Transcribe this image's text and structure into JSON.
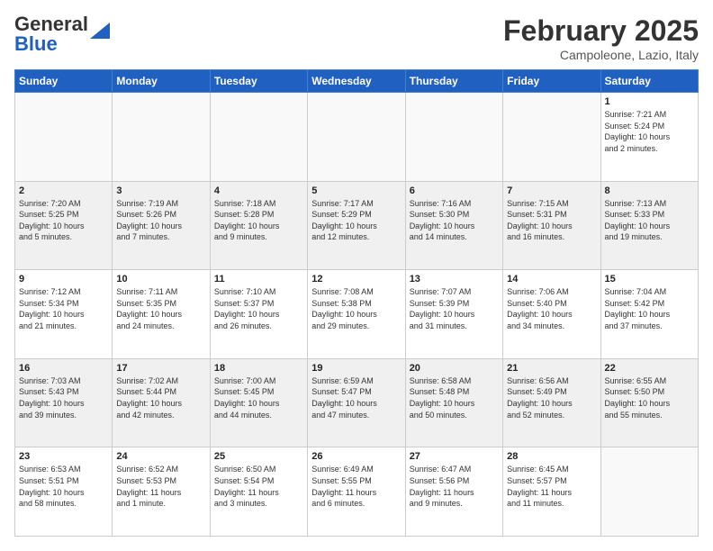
{
  "header": {
    "logo_general": "General",
    "logo_blue": "Blue",
    "month_title": "February 2025",
    "location": "Campoleone, Lazio, Italy"
  },
  "weekdays": [
    "Sunday",
    "Monday",
    "Tuesday",
    "Wednesday",
    "Thursday",
    "Friday",
    "Saturday"
  ],
  "weeks": [
    [
      {
        "day": "",
        "info": ""
      },
      {
        "day": "",
        "info": ""
      },
      {
        "day": "",
        "info": ""
      },
      {
        "day": "",
        "info": ""
      },
      {
        "day": "",
        "info": ""
      },
      {
        "day": "",
        "info": ""
      },
      {
        "day": "1",
        "info": "Sunrise: 7:21 AM\nSunset: 5:24 PM\nDaylight: 10 hours\nand 2 minutes."
      }
    ],
    [
      {
        "day": "2",
        "info": "Sunrise: 7:20 AM\nSunset: 5:25 PM\nDaylight: 10 hours\nand 5 minutes."
      },
      {
        "day": "3",
        "info": "Sunrise: 7:19 AM\nSunset: 5:26 PM\nDaylight: 10 hours\nand 7 minutes."
      },
      {
        "day": "4",
        "info": "Sunrise: 7:18 AM\nSunset: 5:28 PM\nDaylight: 10 hours\nand 9 minutes."
      },
      {
        "day": "5",
        "info": "Sunrise: 7:17 AM\nSunset: 5:29 PM\nDaylight: 10 hours\nand 12 minutes."
      },
      {
        "day": "6",
        "info": "Sunrise: 7:16 AM\nSunset: 5:30 PM\nDaylight: 10 hours\nand 14 minutes."
      },
      {
        "day": "7",
        "info": "Sunrise: 7:15 AM\nSunset: 5:31 PM\nDaylight: 10 hours\nand 16 minutes."
      },
      {
        "day": "8",
        "info": "Sunrise: 7:13 AM\nSunset: 5:33 PM\nDaylight: 10 hours\nand 19 minutes."
      }
    ],
    [
      {
        "day": "9",
        "info": "Sunrise: 7:12 AM\nSunset: 5:34 PM\nDaylight: 10 hours\nand 21 minutes."
      },
      {
        "day": "10",
        "info": "Sunrise: 7:11 AM\nSunset: 5:35 PM\nDaylight: 10 hours\nand 24 minutes."
      },
      {
        "day": "11",
        "info": "Sunrise: 7:10 AM\nSunset: 5:37 PM\nDaylight: 10 hours\nand 26 minutes."
      },
      {
        "day": "12",
        "info": "Sunrise: 7:08 AM\nSunset: 5:38 PM\nDaylight: 10 hours\nand 29 minutes."
      },
      {
        "day": "13",
        "info": "Sunrise: 7:07 AM\nSunset: 5:39 PM\nDaylight: 10 hours\nand 31 minutes."
      },
      {
        "day": "14",
        "info": "Sunrise: 7:06 AM\nSunset: 5:40 PM\nDaylight: 10 hours\nand 34 minutes."
      },
      {
        "day": "15",
        "info": "Sunrise: 7:04 AM\nSunset: 5:42 PM\nDaylight: 10 hours\nand 37 minutes."
      }
    ],
    [
      {
        "day": "16",
        "info": "Sunrise: 7:03 AM\nSunset: 5:43 PM\nDaylight: 10 hours\nand 39 minutes."
      },
      {
        "day": "17",
        "info": "Sunrise: 7:02 AM\nSunset: 5:44 PM\nDaylight: 10 hours\nand 42 minutes."
      },
      {
        "day": "18",
        "info": "Sunrise: 7:00 AM\nSunset: 5:45 PM\nDaylight: 10 hours\nand 44 minutes."
      },
      {
        "day": "19",
        "info": "Sunrise: 6:59 AM\nSunset: 5:47 PM\nDaylight: 10 hours\nand 47 minutes."
      },
      {
        "day": "20",
        "info": "Sunrise: 6:58 AM\nSunset: 5:48 PM\nDaylight: 10 hours\nand 50 minutes."
      },
      {
        "day": "21",
        "info": "Sunrise: 6:56 AM\nSunset: 5:49 PM\nDaylight: 10 hours\nand 52 minutes."
      },
      {
        "day": "22",
        "info": "Sunrise: 6:55 AM\nSunset: 5:50 PM\nDaylight: 10 hours\nand 55 minutes."
      }
    ],
    [
      {
        "day": "23",
        "info": "Sunrise: 6:53 AM\nSunset: 5:51 PM\nDaylight: 10 hours\nand 58 minutes."
      },
      {
        "day": "24",
        "info": "Sunrise: 6:52 AM\nSunset: 5:53 PM\nDaylight: 11 hours\nand 1 minute."
      },
      {
        "day": "25",
        "info": "Sunrise: 6:50 AM\nSunset: 5:54 PM\nDaylight: 11 hours\nand 3 minutes."
      },
      {
        "day": "26",
        "info": "Sunrise: 6:49 AM\nSunset: 5:55 PM\nDaylight: 11 hours\nand 6 minutes."
      },
      {
        "day": "27",
        "info": "Sunrise: 6:47 AM\nSunset: 5:56 PM\nDaylight: 11 hours\nand 9 minutes."
      },
      {
        "day": "28",
        "info": "Sunrise: 6:45 AM\nSunset: 5:57 PM\nDaylight: 11 hours\nand 11 minutes."
      },
      {
        "day": "",
        "info": ""
      }
    ]
  ]
}
